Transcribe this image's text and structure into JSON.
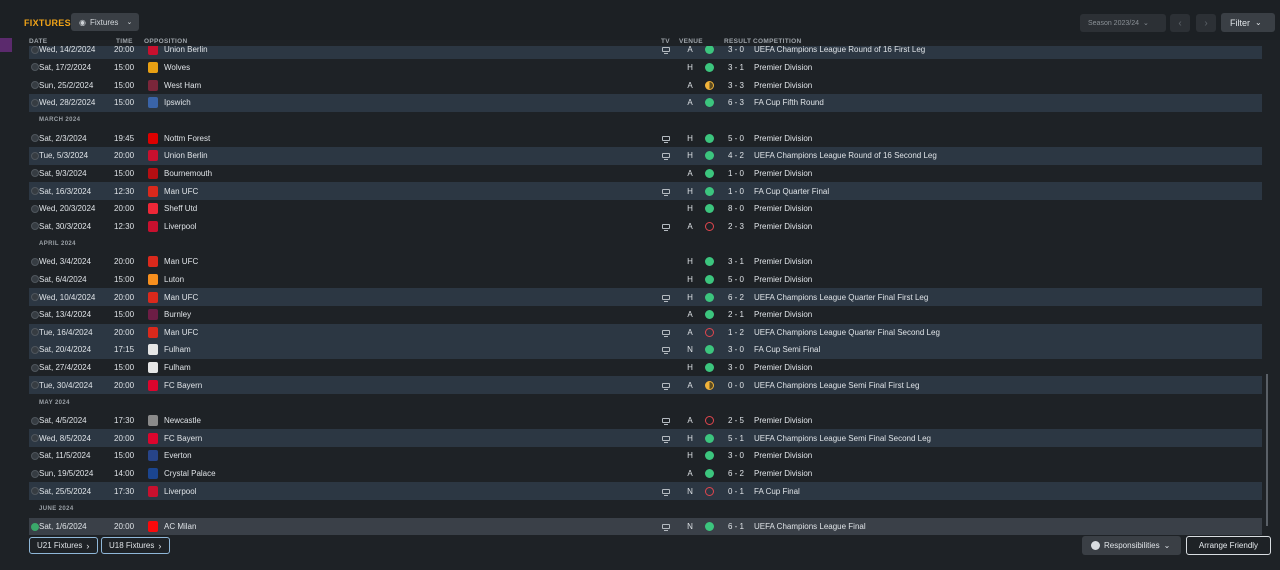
{
  "header": {
    "title": "FIXTURES",
    "view_dropdown": "Fixtures",
    "season": "Season 2023/24",
    "filter": "Filter"
  },
  "columns": {
    "date": "DATE",
    "time": "TIME",
    "opposition": "OPPOSITION",
    "tv": "TV",
    "venue": "VENUE",
    "result": "RESULT",
    "competition": "COMPETITION"
  },
  "rows": [
    {
      "type": "match",
      "date": "Wed, 14/2/2024",
      "time": "20:00",
      "opp": "Union Berlin",
      "crest": "#c8102e",
      "tv": true,
      "venue": "A",
      "res": "W",
      "score": "3 - 0",
      "comp": "UEFA Champions League Round of 16 First Leg",
      "shade": "alt"
    },
    {
      "type": "match",
      "date": "Sat, 17/2/2024",
      "time": "15:00",
      "opp": "Wolves",
      "crest": "#e8a013",
      "tv": false,
      "venue": "H",
      "res": "W",
      "score": "3 - 1",
      "comp": "Premier Division",
      "shade": ""
    },
    {
      "type": "match",
      "date": "Sun, 25/2/2024",
      "time": "15:00",
      "opp": "West Ham",
      "crest": "#7a263a",
      "tv": false,
      "venue": "A",
      "res": "D",
      "score": "3 - 3",
      "comp": "Premier Division",
      "shade": ""
    },
    {
      "type": "match",
      "date": "Wed, 28/2/2024",
      "time": "15:00",
      "opp": "Ipswich",
      "crest": "#3a64a8",
      "tv": false,
      "venue": "A",
      "res": "W",
      "score": "6 - 3",
      "comp": "FA Cup Fifth Round",
      "shade": "alt"
    },
    {
      "type": "month",
      "label": "MARCH 2024"
    },
    {
      "type": "match",
      "date": "Sat, 2/3/2024",
      "time": "19:45",
      "opp": "Nottm Forest",
      "crest": "#dd0000",
      "tv": true,
      "venue": "H",
      "res": "W",
      "score": "5 - 0",
      "comp": "Premier Division",
      "shade": ""
    },
    {
      "type": "match",
      "date": "Tue, 5/3/2024",
      "time": "20:00",
      "opp": "Union Berlin",
      "crest": "#c8102e",
      "tv": true,
      "venue": "H",
      "res": "W",
      "score": "4 - 2",
      "comp": "UEFA Champions League Round of 16 Second Leg",
      "shade": "alt"
    },
    {
      "type": "match",
      "date": "Sat, 9/3/2024",
      "time": "15:00",
      "opp": "Bournemouth",
      "crest": "#b50e12",
      "tv": false,
      "venue": "A",
      "res": "W",
      "score": "1 - 0",
      "comp": "Premier Division",
      "shade": ""
    },
    {
      "type": "match",
      "date": "Sat, 16/3/2024",
      "time": "12:30",
      "opp": "Man UFC",
      "crest": "#da291c",
      "tv": true,
      "venue": "H",
      "res": "W",
      "score": "1 - 0",
      "comp": "FA Cup Quarter Final",
      "shade": "alt"
    },
    {
      "type": "match",
      "date": "Wed, 20/3/2024",
      "time": "20:00",
      "opp": "Sheff Utd",
      "crest": "#ee2737",
      "tv": false,
      "venue": "H",
      "res": "W",
      "score": "8 - 0",
      "comp": "Premier Division",
      "shade": ""
    },
    {
      "type": "match",
      "date": "Sat, 30/3/2024",
      "time": "12:30",
      "opp": "Liverpool",
      "crest": "#c8102e",
      "tv": true,
      "venue": "A",
      "res": "L",
      "score": "2 - 3",
      "comp": "Premier Division",
      "shade": ""
    },
    {
      "type": "month",
      "label": "APRIL 2024"
    },
    {
      "type": "match",
      "date": "Wed, 3/4/2024",
      "time": "20:00",
      "opp": "Man UFC",
      "crest": "#da291c",
      "tv": false,
      "venue": "H",
      "res": "W",
      "score": "3 - 1",
      "comp": "Premier Division",
      "shade": ""
    },
    {
      "type": "match",
      "date": "Sat, 6/4/2024",
      "time": "15:00",
      "opp": "Luton",
      "crest": "#f78f1e",
      "tv": false,
      "venue": "H",
      "res": "W",
      "score": "5 - 0",
      "comp": "Premier Division",
      "shade": ""
    },
    {
      "type": "match",
      "date": "Wed, 10/4/2024",
      "time": "20:00",
      "opp": "Man UFC",
      "crest": "#da291c",
      "tv": true,
      "venue": "H",
      "res": "W",
      "score": "6 - 2",
      "comp": "UEFA Champions League Quarter Final First Leg",
      "shade": "alt"
    },
    {
      "type": "match",
      "date": "Sat, 13/4/2024",
      "time": "15:00",
      "opp": "Burnley",
      "crest": "#6c1d45",
      "tv": false,
      "venue": "A",
      "res": "W",
      "score": "2 - 1",
      "comp": "Premier Division",
      "shade": ""
    },
    {
      "type": "match",
      "date": "Tue, 16/4/2024",
      "time": "20:00",
      "opp": "Man UFC",
      "crest": "#da291c",
      "tv": true,
      "venue": "A",
      "res": "L",
      "score": "1 - 2",
      "comp": "UEFA Champions League Quarter Final Second Leg",
      "shade": "alt"
    },
    {
      "type": "match",
      "date": "Sat, 20/4/2024",
      "time": "17:15",
      "opp": "Fulham",
      "crest": "#e6e6e6",
      "tv": true,
      "venue": "N",
      "res": "W",
      "score": "3 - 0",
      "comp": "FA Cup Semi Final",
      "shade": "alt"
    },
    {
      "type": "match",
      "date": "Sat, 27/4/2024",
      "time": "15:00",
      "opp": "Fulham",
      "crest": "#e6e6e6",
      "tv": false,
      "venue": "H",
      "res": "W",
      "score": "3 - 0",
      "comp": "Premier Division",
      "shade": ""
    },
    {
      "type": "match",
      "date": "Tue, 30/4/2024",
      "time": "20:00",
      "opp": "FC Bayern",
      "crest": "#dc052d",
      "tv": true,
      "venue": "A",
      "res": "D",
      "score": "0 - 0",
      "comp": "UEFA Champions League Semi Final First Leg",
      "shade": "alt"
    },
    {
      "type": "month",
      "label": "MAY 2024"
    },
    {
      "type": "match",
      "date": "Sat, 4/5/2024",
      "time": "17:30",
      "opp": "Newcastle",
      "crest": "#8a8a8a",
      "tv": true,
      "venue": "A",
      "res": "L",
      "score": "2 - 5",
      "comp": "Premier Division",
      "shade": ""
    },
    {
      "type": "match",
      "date": "Wed, 8/5/2024",
      "time": "20:00",
      "opp": "FC Bayern",
      "crest": "#dc052d",
      "tv": true,
      "venue": "H",
      "res": "W",
      "score": "5 - 1",
      "comp": "UEFA Champions League Semi Final Second Leg",
      "shade": "alt"
    },
    {
      "type": "match",
      "date": "Sat, 11/5/2024",
      "time": "15:00",
      "opp": "Everton",
      "crest": "#274488",
      "tv": false,
      "venue": "H",
      "res": "W",
      "score": "3 - 0",
      "comp": "Premier Division",
      "shade": ""
    },
    {
      "type": "match",
      "date": "Sun, 19/5/2024",
      "time": "14:00",
      "opp": "Crystal Palace",
      "crest": "#1b458f",
      "tv": false,
      "venue": "A",
      "res": "W",
      "score": "6 - 2",
      "comp": "Premier Division",
      "shade": ""
    },
    {
      "type": "match",
      "date": "Sat, 25/5/2024",
      "time": "17:30",
      "opp": "Liverpool",
      "crest": "#c8102e",
      "tv": true,
      "venue": "N",
      "res": "L",
      "score": "0 - 1",
      "comp": "FA Cup Final",
      "shade": "alt"
    },
    {
      "type": "month",
      "label": "JUNE 2024"
    },
    {
      "type": "match",
      "date": "Sat, 1/6/2024",
      "time": "20:00",
      "opp": "AC Milan",
      "crest": "#fb090b",
      "tv": true,
      "venue": "N",
      "res": "W",
      "score": "6 - 1",
      "comp": "UEFA Champions League Final",
      "shade": "sel",
      "done": true
    }
  ],
  "footer": {
    "u21": "U21 Fixtures",
    "u18": "U18 Fixtures",
    "responsibilities": "Responsibilities",
    "arrange": "Arrange Friendly"
  },
  "colors": {
    "accent": "#f0a318",
    "win": "#3cc57e",
    "draw": "#f0b23a",
    "loss": "#e0464e"
  },
  "icons": {
    "view": "eye-icon",
    "chevron": "chevron-down-icon",
    "prev": "chevron-left-icon",
    "next": "chevron-right-icon",
    "tv": "tv-icon",
    "globe": "globe-icon"
  }
}
